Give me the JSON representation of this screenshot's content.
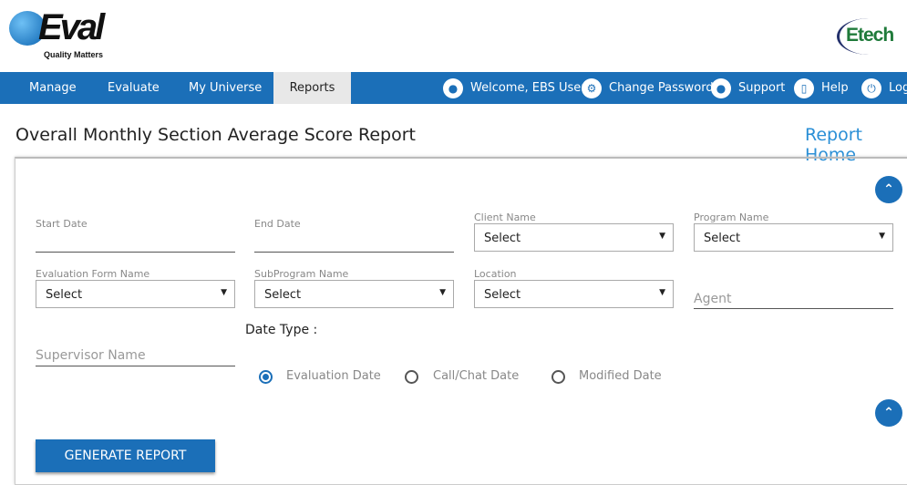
{
  "brand": {
    "logo_text": "Q:Eval",
    "tagline": "Quality Matters",
    "partner_logo": "Etech"
  },
  "nav": {
    "items": [
      "Manage",
      "Evaluate",
      "My Universe",
      "Reports"
    ],
    "active": "Reports",
    "right": [
      {
        "icon": "user-icon",
        "label": "Welcome, EBS User"
      },
      {
        "icon": "gear-icon",
        "label": "Change Password"
      },
      {
        "icon": "support-icon",
        "label": "Support"
      },
      {
        "icon": "book-icon",
        "label": "Help"
      },
      {
        "icon": "power-icon",
        "label": "Logout"
      }
    ]
  },
  "page": {
    "title": "Overall Monthly Section Average Score Report",
    "report_home": "Report Home"
  },
  "form": {
    "start_date": "Start Date",
    "end_date": "End Date",
    "client_name": {
      "label": "Client Name",
      "value": "Select"
    },
    "program_name": {
      "label": "Program Name",
      "value": "Select"
    },
    "evaluation_form": {
      "label": "Evaluation Form Name",
      "value": "Select"
    },
    "subprogram": {
      "label": "SubProgram Name",
      "value": "Select"
    },
    "location": {
      "label": "Location",
      "value": "Select"
    },
    "agent": "Agent",
    "supervisor": "Supervisor Name",
    "date_type_label": "Date Type :",
    "date_types": [
      "Evaluation Date",
      "Call/Chat Date",
      "Modified Date"
    ],
    "date_type_selected": "Evaluation Date",
    "generate": "GENERATE REPORT"
  },
  "colors": {
    "primary": "#1b6fb8",
    "link": "#2a8fd6"
  }
}
